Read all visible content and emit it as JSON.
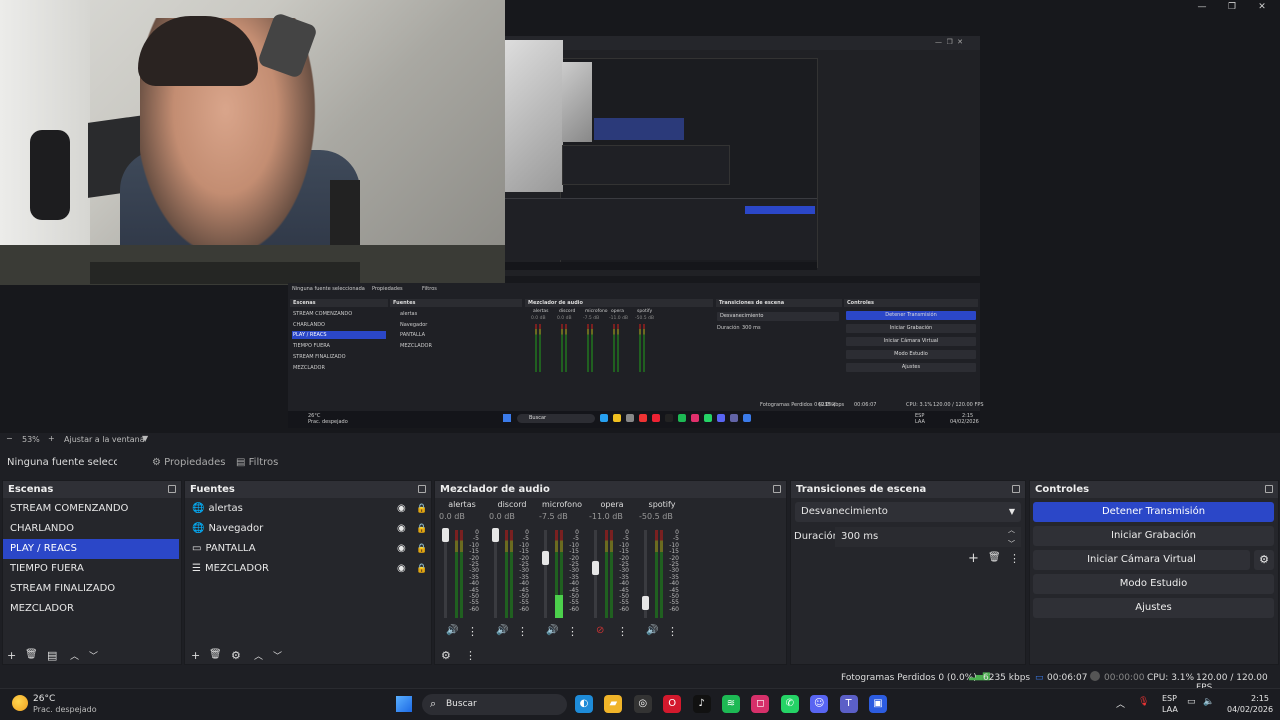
{
  "preview": {
    "nested_props": {
      "no_source": "Ninguna fuente seleccionada",
      "properties": "Propiedades",
      "filters": "Filtros"
    },
    "nested_docks": {
      "scenes": "Escenas",
      "sources": "Fuentes",
      "mixer": "Mezclador de audio",
      "transitions": "Transiciones de escena",
      "controls": "Controles",
      "scene_items": [
        "STREAM COMENZANDO",
        "CHARLANDO",
        "PLAY / REACS",
        "TIEMPO FUERA",
        "STREAM FINALIZADO",
        "MEZCLADOR"
      ],
      "source_items": [
        "alertas",
        "Navegador",
        "PANTALLA",
        "MEZCLADOR"
      ],
      "channels": [
        "alertas",
        "discord",
        "microfono",
        "opera",
        "spotify"
      ],
      "channel_db": [
        "0.0 dB",
        "0.0 dB",
        "-7.5 dB",
        "-11.0 dB",
        "-50.5 dB"
      ],
      "transition": "Desvanecimiento",
      "duration_label": "Duración",
      "duration": "300 ms",
      "ctl": [
        "Detener Transmisión",
        "Iniciar Grabación",
        "Iniciar Cámara Virtual",
        "Modo Estudio",
        "Ajustes"
      ],
      "status": "Fotogramas Perdidos 0 (0.0%)",
      "kbps": "6235 kbps",
      "time": "00:06:07",
      "cpu": "CPU: 3.1%",
      "fps": "120.00 / 120.00 FPS",
      "weather_temp": "26°C",
      "weather_desc": "Prac. despejado",
      "search": "Buscar",
      "lang": "ESP",
      "lang2": "LAA",
      "clock": "2:15",
      "date": "04/02/2026"
    }
  },
  "zoom": {
    "minus": "−",
    "value": "53%",
    "plus": "+",
    "fit": "Ajustar a la ventana"
  },
  "props_bar": {
    "no_source": "Ninguna fuente seleccionada",
    "properties": "Propiedades",
    "filters": "Filtros"
  },
  "scenes": {
    "title": "Escenas",
    "items": [
      "STREAM COMENZANDO",
      "CHARLANDO",
      "PLAY / REACS",
      "TIEMPO FUERA",
      "STREAM FINALIZADO",
      "MEZCLADOR"
    ],
    "selected_index": 2
  },
  "sources": {
    "title": "Fuentes",
    "items": [
      {
        "name": "alertas",
        "icon": "globe-icon"
      },
      {
        "name": "Navegador",
        "icon": "globe-icon"
      },
      {
        "name": "PANTALLA",
        "icon": "monitor-icon"
      },
      {
        "name": "MEZCLADOR",
        "icon": "list-icon"
      }
    ]
  },
  "mixer": {
    "title": "Mezclador de audio",
    "scale": [
      "0",
      "-5",
      "-10",
      "-15",
      "-20",
      "-25",
      "-30",
      "-35",
      "-40",
      "-45",
      "-50",
      "-55",
      "-60"
    ],
    "channels": [
      {
        "name": "alertas",
        "db": "0.0 dB",
        "level": 1.0,
        "muted": false
      },
      {
        "name": "discord",
        "db": "0.0 dB",
        "level": 1.0,
        "muted": false
      },
      {
        "name": "microfono",
        "db": "-7.5 dB",
        "level": 0.72,
        "muted": false
      },
      {
        "name": "opera",
        "db": "-11.0 dB",
        "level": 0.6,
        "muted": true
      },
      {
        "name": "spotify",
        "db": "-50.5 dB",
        "level": 0.2,
        "muted": false
      }
    ]
  },
  "transitions": {
    "title": "Transiciones de escena",
    "selected": "Desvanecimiento",
    "duration_label": "Duración",
    "duration": "300 ms"
  },
  "controls": {
    "title": "Controles",
    "stop_stream": "Detener Transmisión",
    "start_recording": "Iniciar Grabación",
    "start_virtual_cam": "Iniciar Cámara Virtual",
    "studio_mode": "Modo Estudio",
    "settings": "Ajustes"
  },
  "status": {
    "dropped": "Fotogramas Perdidos 0 (0.0%)",
    "kbps": "6235 kbps",
    "live_time": "00:06:07",
    "rec_time": "00:00:00",
    "cpu": "CPU: 3.1%",
    "fps": "120.00 / 120.00 FPS"
  },
  "taskbar": {
    "weather_temp": "26°C",
    "weather_desc": "Prac. despejado",
    "search_placeholder": "Buscar",
    "lang": "ESP",
    "lang_sub": "LAA",
    "time": "2:15",
    "date": "04/02/2026"
  },
  "colors": {
    "accent": "#2b47c8",
    "panel": "#25262b",
    "background": "#1e1f24"
  }
}
